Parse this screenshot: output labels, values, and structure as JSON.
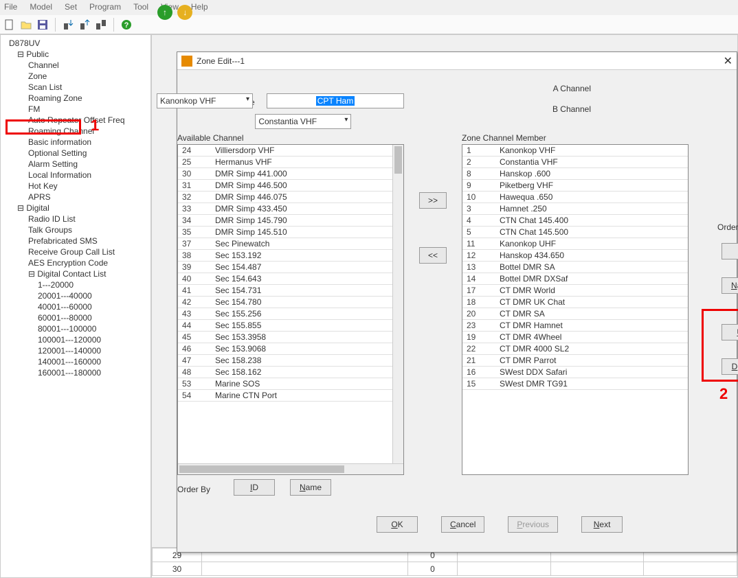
{
  "menubar": {
    "file": "File",
    "model": "Model",
    "set": "Set",
    "program": "Program",
    "tool": "Tool",
    "view": "View",
    "help": "Help"
  },
  "toolbar_icons": {
    "new": "□",
    "open": "📂",
    "save": "💾",
    "read": "⬇",
    "write": "↕",
    "wr2": "↣",
    "help": "?"
  },
  "arrows": {
    "up": "↑",
    "down": "↓"
  },
  "tree": {
    "root": "D878UV",
    "public": {
      "label": "Public",
      "items": [
        "Channel",
        "Zone",
        "Scan List",
        "Roaming Zone",
        "FM",
        "Auto Repeater Offset Freq",
        "Roaming Channel",
        "Basic information",
        "Optional Setting",
        "Alarm Setting",
        "Local Information",
        "Hot Key",
        "APRS"
      ]
    },
    "digital": {
      "label": "Digital",
      "items": [
        "Radio ID List",
        "Talk Groups",
        "Prefabricated SMS",
        "Receive Group Call List",
        "AES Encryption Code"
      ]
    },
    "dcl": {
      "label": "Digital Contact List",
      "items": [
        "1---20000",
        "20001---40000",
        "40001---60000",
        "60001---80000",
        "80001---100000",
        "100001---120000",
        "120001---140000",
        "140001---160000",
        "160001---180000"
      ]
    }
  },
  "annot": {
    "one": "1",
    "two": "2"
  },
  "dialog": {
    "title": "Zone Edit---1",
    "zone_name_label": "Zone Name",
    "zone_name_value": "CPT Ham",
    "a_ch_label": "A Channel",
    "a_ch_value": "Kanonkop VHF",
    "b_ch_label": "B Channel",
    "b_ch_value": "Constantia VHF",
    "avail_label": "Available Channel",
    "member_label": "Zone Channel Member",
    "move_right": ">>",
    "move_left": "<<",
    "order_by_label": "Order By",
    "id_btn": "ID",
    "name_btn": "Name",
    "up_btn": "Up",
    "down_btn": "Down",
    "ok_btn": "OK",
    "cancel_btn": "Cancel",
    "prev_btn": "Previous",
    "next_btn": "Next",
    "available": [
      {
        "n": "24",
        "name": "Villiersdorp VHF"
      },
      {
        "n": "25",
        "name": "Hermanus VHF"
      },
      {
        "n": "30",
        "name": "DMR Simp 441.000"
      },
      {
        "n": "31",
        "name": "DMR Simp 446.500"
      },
      {
        "n": "32",
        "name": "DMR Simp 446.075"
      },
      {
        "n": "33",
        "name": "DMR Simp 433.450"
      },
      {
        "n": "34",
        "name": "DMR Simp 145.790"
      },
      {
        "n": "35",
        "name": "DMR Simp 145.510"
      },
      {
        "n": "37",
        "name": "Sec Pinewatch"
      },
      {
        "n": "38",
        "name": "Sec 153.192"
      },
      {
        "n": "39",
        "name": "Sec 154.487"
      },
      {
        "n": "40",
        "name": "Sec 154.643"
      },
      {
        "n": "41",
        "name": "Sec 154.731"
      },
      {
        "n": "42",
        "name": "Sec 154.780"
      },
      {
        "n": "43",
        "name": "Sec 155.256"
      },
      {
        "n": "44",
        "name": "Sec 155.855"
      },
      {
        "n": "45",
        "name": "Sec 153.3958"
      },
      {
        "n": "46",
        "name": "Sec 153.9068"
      },
      {
        "n": "47",
        "name": "Sec 158.238"
      },
      {
        "n": "48",
        "name": "Sec 158.162"
      },
      {
        "n": "53",
        "name": "Marine SOS"
      },
      {
        "n": "54",
        "name": "Marine CTN Port"
      }
    ],
    "members": [
      {
        "n": "1",
        "name": "Kanonkop VHF"
      },
      {
        "n": "2",
        "name": "Constantia VHF"
      },
      {
        "n": "8",
        "name": "Hanskop .600"
      },
      {
        "n": "9",
        "name": "Piketberg VHF"
      },
      {
        "n": "10",
        "name": "Hawequa .650"
      },
      {
        "n": "3",
        "name": "Hamnet .250"
      },
      {
        "n": "4",
        "name": "CTN Chat 145.400"
      },
      {
        "n": "5",
        "name": "CTN Chat 145.500"
      },
      {
        "n": "11",
        "name": "Kanonkop UHF"
      },
      {
        "n": "12",
        "name": "Hanskop 434.650"
      },
      {
        "n": "13",
        "name": "Bottel DMR SA"
      },
      {
        "n": "14",
        "name": "Bottel DMR DXSaf"
      },
      {
        "n": "17",
        "name": "CT DMR World"
      },
      {
        "n": "18",
        "name": "CT DMR UK Chat"
      },
      {
        "n": "20",
        "name": "CT DMR SA"
      },
      {
        "n": "23",
        "name": "CT DMR Hamnet"
      },
      {
        "n": "19",
        "name": "CT DMR 4Wheel"
      },
      {
        "n": "22",
        "name": "CT DMR 4000 SL2"
      },
      {
        "n": "21",
        "name": "CT DMR Parrot"
      },
      {
        "n": "16",
        "name": "SWest DDX Safari"
      },
      {
        "n": "15",
        "name": "SWest DMR TG91"
      }
    ]
  },
  "bottomrow": {
    "a": "29",
    "b": "",
    "c": "0",
    "d": "",
    "e": "",
    "f": "",
    "a2": "30",
    "b2": "",
    "c2": "0",
    "d2": "",
    "e2": "",
    "f2": ""
  }
}
